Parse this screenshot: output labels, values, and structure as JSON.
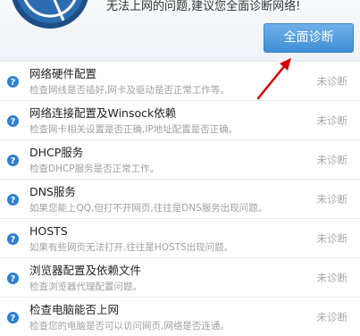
{
  "header": {
    "subtitle": "无法上网的问题,建议您全面诊断网络!",
    "diagnose_button": "全面诊断",
    "colors": {
      "button": "#4a9ae0",
      "arrow": "#d40000",
      "help_icon": "#2f7fd0"
    }
  },
  "items": [
    {
      "title": "网络硬件配置",
      "desc": "检查网线是否插好,网卡及驱动是否正常工作等。",
      "status": "未诊断",
      "icon": "help-icon"
    },
    {
      "title": "网络连接配置及Winsock依赖",
      "desc": "检查网卡相关设置是否正确,IP地址配置是否正确。",
      "status": "未诊断",
      "icon": "help-icon"
    },
    {
      "title": "DHCP服务",
      "desc": "检查DHCP服务是否正常工作。",
      "status": "未诊断",
      "icon": "help-icon"
    },
    {
      "title": "DNS服务",
      "desc": "如果您能上QQ,但打不开网页,往往是DNS服务出现问题。",
      "status": "未诊断",
      "icon": "help-icon"
    },
    {
      "title": "HOSTS",
      "desc": "如果有些网页无法打开,往往是HOSTS出现问题。",
      "status": "未诊断",
      "icon": "help-icon"
    },
    {
      "title": "浏览器配置及依赖文件",
      "desc": "检查浏览器代理配置问题。",
      "status": "未诊断",
      "icon": "help-icon"
    },
    {
      "title": "检查电脑能否上网",
      "desc": "检查您的电脑是否可以访问网页,网络是否连通。",
      "status": "未诊断",
      "icon": "help-icon"
    }
  ]
}
